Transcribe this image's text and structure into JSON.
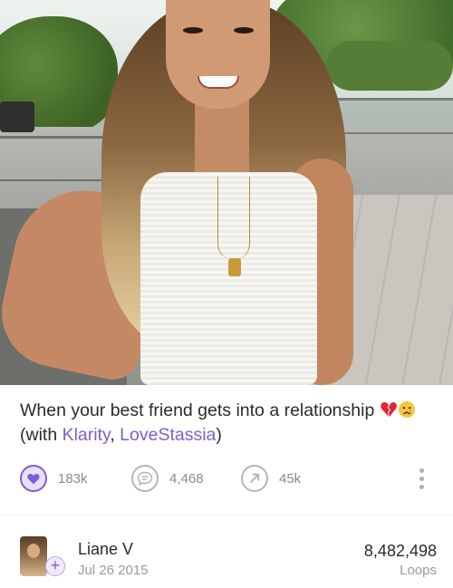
{
  "post": {
    "caption_text": "When your best friend gets into a relationship ",
    "with_prefix": "(with ",
    "mentions": [
      "Klarity",
      "LoveStassia"
    ],
    "mention_sep": ", ",
    "with_suffix": ")",
    "emojis": [
      "broken-heart-icon",
      "crying-face-icon"
    ]
  },
  "actions": {
    "likes": "183k",
    "comments": "4,468",
    "revines": "45k"
  },
  "author": {
    "name": "Liane V",
    "date": "Jul 26 2015",
    "follow_symbol": "+"
  },
  "stats": {
    "loops_count": "8,482,498",
    "loops_label": "Loops"
  },
  "colors": {
    "accent": "#7c5fd1",
    "muted": "#8a8a8a"
  }
}
